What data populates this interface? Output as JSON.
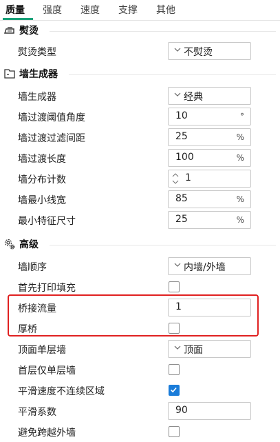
{
  "tabs": [
    "质量",
    "强度",
    "速度",
    "支撑",
    "其他"
  ],
  "active_tab": "质量",
  "sections": {
    "ironing": {
      "title": "熨烫",
      "icon": "iron-icon",
      "rows": {
        "ironing_type": {
          "label": "熨烫类型",
          "value": "不熨烫"
        }
      }
    },
    "wall_generator": {
      "title": "墙生成器",
      "icon": "wall-icon",
      "rows": {
        "generator": {
          "label": "墙生成器",
          "value": "经典"
        },
        "transition_angle": {
          "label": "墙过渡阈值角度",
          "value": "10",
          "unit": "°"
        },
        "transition_filter": {
          "label": "墙过渡过滤间距",
          "value": "25",
          "unit": "%"
        },
        "transition_length": {
          "label": "墙过渡长度",
          "value": "100",
          "unit": "%"
        },
        "distribution_count": {
          "label": "墙分布计数",
          "value": "1"
        },
        "min_width": {
          "label": "墙最小线宽",
          "value": "85",
          "unit": "%"
        },
        "min_feature": {
          "label": "最小特征尺寸",
          "value": "25",
          "unit": "%"
        }
      }
    },
    "advanced": {
      "title": "高级",
      "icon": "gear-icon",
      "rows": {
        "wall_order": {
          "label": "墙顺序",
          "value": "内墙/外墙"
        },
        "infill_first": {
          "label": "首先打印填充",
          "checked": false
        },
        "bridge_flow": {
          "label": "桥接流量",
          "value": "1"
        },
        "thick_bridges": {
          "label": "厚桥",
          "checked": false
        },
        "top_single_wall": {
          "label": "顶面单层墙",
          "value": "顶面"
        },
        "first_layer_single_wall": {
          "label": "首层仅单层墙",
          "checked": false
        },
        "smooth_speed": {
          "label": "平滑速度不连续区域",
          "checked": true
        },
        "smooth_coef": {
          "label": "平滑系数",
          "value": "90"
        },
        "avoid_crossing": {
          "label": "避免跨越外墙",
          "checked": false
        }
      }
    }
  },
  "colors": {
    "accent": "#1aa27a",
    "checkbox_checked": "#1a7cd9",
    "highlight": "#e02020"
  }
}
